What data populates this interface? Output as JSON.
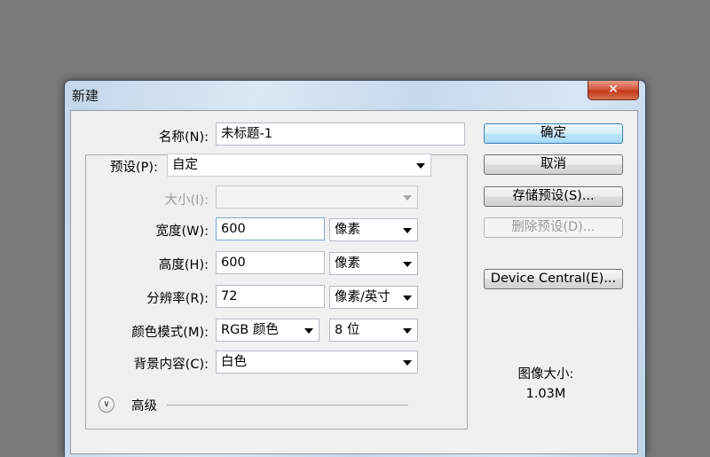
{
  "dialog": {
    "title": "新建",
    "close_symbol": "✕"
  },
  "form": {
    "name_label": "名称(N):",
    "name_value": "未标题-1",
    "preset_label": "预设(P):",
    "preset_value": "自定",
    "size_label": "大小(I):",
    "size_value": "",
    "width_label": "宽度(W):",
    "width_value": "600",
    "width_unit": "像素",
    "height_label": "高度(H):",
    "height_value": "600",
    "height_unit": "像素",
    "resolution_label": "分辨率(R):",
    "resolution_value": "72",
    "resolution_unit": "像素/英寸",
    "color_mode_label": "颜色模式(M):",
    "color_mode_value": "RGB 颜色",
    "bit_depth_value": "8 位",
    "background_label": "背景内容(C):",
    "background_value": "白色",
    "advanced_label": "高级"
  },
  "buttons": {
    "ok": "确定",
    "cancel": "取消",
    "save_preset": "存储预设(S)...",
    "delete_preset": "删除预设(D)...",
    "device_central": "Device Central(E)..."
  },
  "image_size": {
    "label": "图像大小:",
    "value": "1.03M"
  },
  "icons": {
    "close": "close-icon",
    "dropdown": "chevron-down-icon",
    "advanced_toggle": "double-chevron-down-icon"
  }
}
